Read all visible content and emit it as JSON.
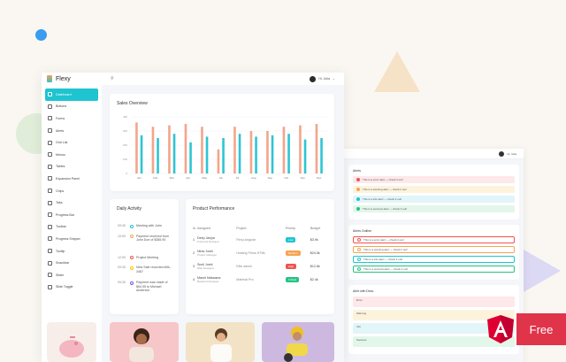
{
  "brand": {
    "name": "Flexy"
  },
  "topbar": {
    "greeting": "Hi, Julia"
  },
  "sidebar": {
    "items": [
      {
        "label": "Dashboard",
        "active": true
      },
      {
        "label": "Buttons"
      },
      {
        "label": "Forms"
      },
      {
        "label": "Alerts"
      },
      {
        "label": "Grid List"
      },
      {
        "label": "Menus"
      },
      {
        "label": "Tables"
      },
      {
        "label": "Expansion Panel"
      },
      {
        "label": "Chips"
      },
      {
        "label": "Tabs"
      },
      {
        "label": "Progress Bar"
      },
      {
        "label": "Toolbar"
      },
      {
        "label": "Progress Snipper"
      },
      {
        "label": "Tooltip"
      },
      {
        "label": "Snackbar"
      },
      {
        "label": "Slider"
      },
      {
        "label": "Slide Toggle"
      }
    ]
  },
  "sales": {
    "title": "Sales Overview",
    "chart_data": {
      "type": "bar",
      "categories": [
        "Jan",
        "Feb",
        "Mar",
        "Apr",
        "May",
        "Jun",
        "Jul",
        "Aug",
        "Sep",
        "Oct",
        "Nov",
        "Dec"
      ],
      "ylim": [
        0,
        400
      ],
      "yticks": [
        "0",
        "100",
        "200",
        "300",
        "400"
      ],
      "series": [
        {
          "values": [
            360,
            330,
            340,
            350,
            330,
            170,
            330,
            300,
            300,
            330,
            340,
            350
          ]
        },
        {
          "values": [
            270,
            250,
            280,
            220,
            260,
            250,
            280,
            260,
            270,
            280,
            240,
            250
          ]
        }
      ],
      "colors": [
        "#f4a58a",
        "#2ec5d3"
      ]
    }
  },
  "daily": {
    "title": "Daily Activity",
    "items": [
      {
        "time": "09:30",
        "text": "Meeting with John",
        "color": "#1ec4d0"
      },
      {
        "time": "10:00",
        "text": "Payment received from John Doe of $385.90",
        "color": "#f6a352"
      },
      {
        "time": "12:00",
        "text": "Project Meeting",
        "color": "#ef5350"
      },
      {
        "time": "09:30",
        "text": "New Sale recorded #ML-3467",
        "color": "#ffc107"
      },
      {
        "time": "09:30",
        "text": "Payment was made of $64.95 to Michael Anderson",
        "color": "#7c4dff"
      }
    ]
  },
  "performance": {
    "title": "Product Performance",
    "headers": [
      "Id",
      "Assigned",
      "Project",
      "Priority",
      "Budget"
    ],
    "rows": [
      {
        "id": "1",
        "name": "Deep Javiya",
        "role": "Frontend Devloper",
        "project": "Flexy Angular",
        "priority": "Low",
        "color": "#1ec4d0",
        "budget": "$3.9k"
      },
      {
        "id": "2",
        "name": "Nirav Joshi",
        "role": "Project Manager",
        "project": "Hosting Press HTML",
        "priority": "Medium",
        "color": "#f6a352",
        "budget": "$24.5k"
      },
      {
        "id": "3",
        "name": "Sunil Joshi",
        "role": "Web Designer",
        "project": "Elite admin",
        "priority": "High",
        "color": "#ef5350",
        "budget": "$12.8k"
      },
      {
        "id": "4",
        "name": "Maruti Makwana",
        "role": "Backend Devloper",
        "project": "Material Pro",
        "priority": "Critical",
        "color": "#26c281",
        "budget": "$2.4k"
      }
    ]
  },
  "win2": {
    "alerts_title": "Alerts",
    "alerts_outline_title": "Alerts Outline",
    "alerts_desc_title": "Alert with Desc",
    "alerts": [
      {
        "text": "This is a error alert — check it out!",
        "bg": "#fde8ea",
        "dot": "#ef5350"
      },
      {
        "text": "This is a warning alert — check it out!",
        "bg": "#fdf3dd",
        "dot": "#f6a352"
      },
      {
        "text": "This is a info alert — check it out!",
        "bg": "#e2f5f8",
        "dot": "#1ec4d0"
      },
      {
        "text": "This is a success alert — check it out!",
        "bg": "#e3f6ea",
        "dot": "#26c281"
      }
    ],
    "desc": [
      {
        "label": "Error",
        "bg": "#fde8ea"
      },
      {
        "label": "Warning",
        "bg": "#fdf3dd"
      },
      {
        "label": "Info",
        "bg": "#e2f5f8"
      },
      {
        "label": "Success",
        "bg": "#e3f6ea"
      }
    ]
  },
  "promo": {
    "free_label": "Free"
  }
}
